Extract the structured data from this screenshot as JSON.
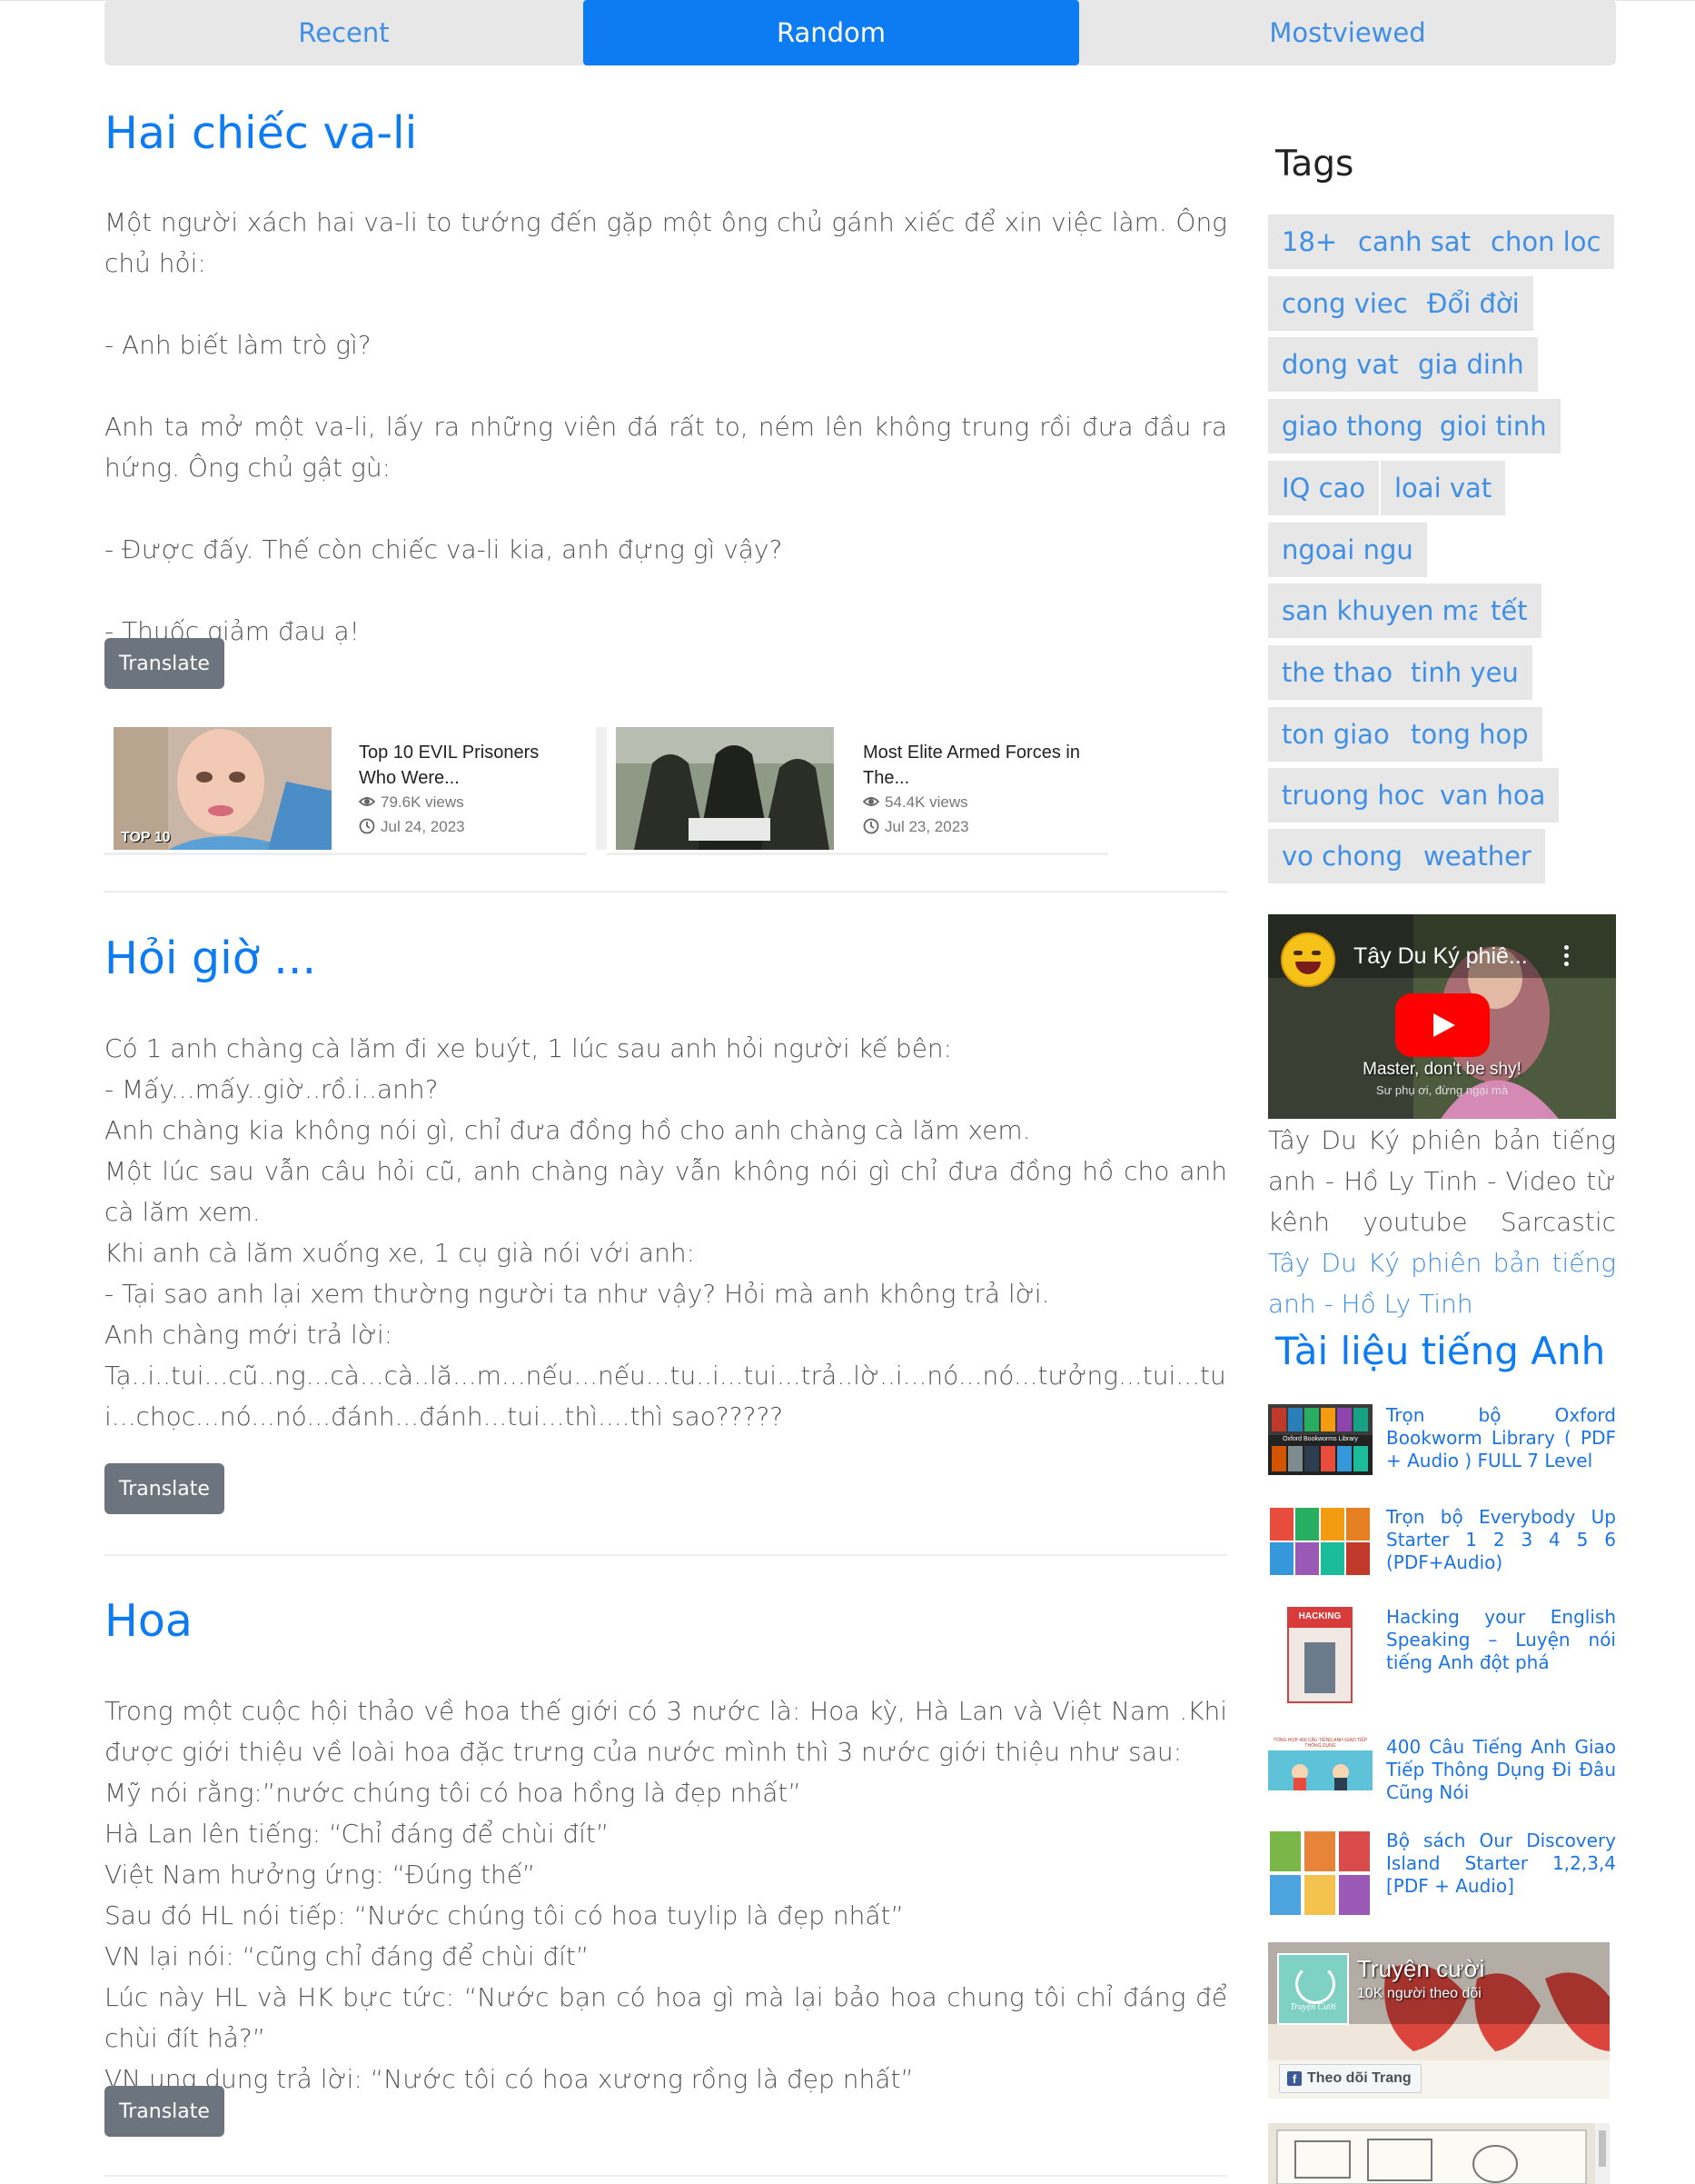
{
  "tabs": [
    {
      "label": "Recent"
    },
    {
      "label": "Random"
    },
    {
      "label": "Mostviewed"
    }
  ],
  "posts": [
    {
      "title": "Hai chiếc va-li",
      "paragraphs": [
        "Một người xách hai va-li to tướng đến gặp một ông chủ gánh xiếc để xin việc làm. Ông chủ hỏi:",
        "- Anh biết làm trò gì?",
        "Anh ta mở một va-li, lấy ra những viên đá rất to, ném lên không trung rồi đưa đầu ra hứng. Ông chủ gật gù:",
        "- Được đấy. Thế còn chiếc va-li kia, anh đựng gì vậy?",
        "- Thuốc giảm đau ạ!"
      ],
      "translate_label": "Translate"
    },
    {
      "title": "Hỏi giờ ...",
      "lines": [
        "Có 1 anh chàng cà lăm đi xe buýt, 1 lúc sau anh hỏi người kế bên:",
        "- Mấy...mấy..giờ..rồ.i..anh?",
        "Anh chàng kia không nói gì, chỉ đưa đồng hồ cho anh chàng cà lăm xem.",
        "Một lúc sau vẫn câu hỏi cũ, anh chàng này vẫn không nói gì chỉ đưa đồng hồ cho anh cà lăm xem.",
        "Khi anh cà lăm xuống xe, 1 cụ già nói với anh:",
        "- Tại sao anh lại xem thường người ta như vậy? Hỏi mà anh không trả lời.",
        "Anh chàng mới trả lời:",
        "Tạ..i..tui...cũ..ng...cà...cà..lă...m...nếu...nếu...tu..i...tui...trả..lờ..i...nó...nó...tưởng...tui...tui...chọc...nó...nó...đánh...đánh...tui...thì....thì sao?????"
      ],
      "translate_label": "Translate"
    },
    {
      "title": "Hoa",
      "lines": [
        "Trong một cuộc hội thảo về hoa thế giới có 3 nước là: Hoa kỳ, Hà Lan và Việt Nam .Khi được giới thiệu về loài hoa đặc trưng của nước mình thì 3 nước giới thiệu như sau:",
        "Mỹ nói rằng:”nước chúng tôi có hoa hồng là đẹp nhất”",
        "Hà Lan lên tiếng: “Chỉ đáng để chùi đít”",
        "Việt Nam hưởng ứng: “Đúng thế”",
        "Sau đó HL nói tiếp: “Nước chúng tôi có hoa tuylip là đẹp nhất”",
        "VN lại nói: “cũng chỉ đáng để chùi đít”",
        "Lúc này HL và HK bực tức: “Nước bạn có hoa gì mà lại bảo hoa chung tôi chỉ đáng để chùi đít hả?”",
        "VN ung dung trả lời: “Nước tôi có hoa xương rồng là đẹp nhất”"
      ],
      "translate_label": "Translate"
    }
  ],
  "videos": [
    {
      "title": "Top 10 EVIL Prisoners Who Were...",
      "views": "79.6K views",
      "date": "Jul 24, 2023",
      "thumb_text": "TOP 10"
    },
    {
      "title": "Most Elite Armed Forces in The...",
      "views": "54.4K views",
      "date": "Jul 23, 2023"
    }
  ],
  "sidebar": {
    "tags_heading": "Tags",
    "tags": [
      "18+",
      "canh sat",
      "chon loc",
      "cong viec",
      "Đổi đời",
      "dong vat",
      "gia dinh",
      "giao thong",
      "gioi tinh",
      "IQ cao",
      "loai vat",
      "ngoai ngu",
      "san khuyen mai",
      "tết",
      "the thao",
      "tinh yeu",
      "ton giao",
      "tong hop",
      "truong hoc",
      "van hoa",
      "vo chong",
      "weather"
    ],
    "youtube": {
      "title": "Tây Du Ký phiê...",
      "subtitle": "Master, don't be shy!",
      "subtitle2": "Sư phụ ơi, đừng ngại mà"
    },
    "yt_caption_text": "Tây Du Ký phiên bản tiếng anh - Hồ Ly Tinh - Video từ kênh youtube Sarcastic",
    "yt_caption_link": "Tây Du Ký phiên bản tiếng anh - Hồ Ly Tinh",
    "docs_heading": "Tài liệu tiếng Anh",
    "docs": [
      {
        "title": "Trọn bộ Oxford Bookworm Library ( PDF + Audio ) FULL 7 Level",
        "thumb_text": "Oxford Bookworms Library"
      },
      {
        "title": "Trọn bộ Everybody Up Starter 1 2 3 4 5 6 (PDF+Audio)"
      },
      {
        "title": "Hacking your English Speaking – Luyện nói tiếng Anh đột phá",
        "thumb_text": "HACKING"
      },
      {
        "title": "400 Câu Tiếng Anh Giao Tiếp Thông Dụng Đi Đâu Cũng Nói",
        "thumb_text": "TỔNG HỢP 400 CÂU TIẾNG ANH GIAO TIẾP THÔNG DỤNG"
      },
      {
        "title": "Bộ sách Our Discovery Island Starter 1,2,3,4 [PDF + Audio]"
      }
    ],
    "fb": {
      "page_name": "Truyện cười",
      "followers": "10K người theo dõi",
      "follow_button": "Theo dõi Trang",
      "logo_text": "Truyện Cười"
    }
  },
  "colors": {
    "accent": "#0d7cf2",
    "tab_bg": "#e7e7e7",
    "button": "#6c757d",
    "link": "#3f8fe6"
  }
}
